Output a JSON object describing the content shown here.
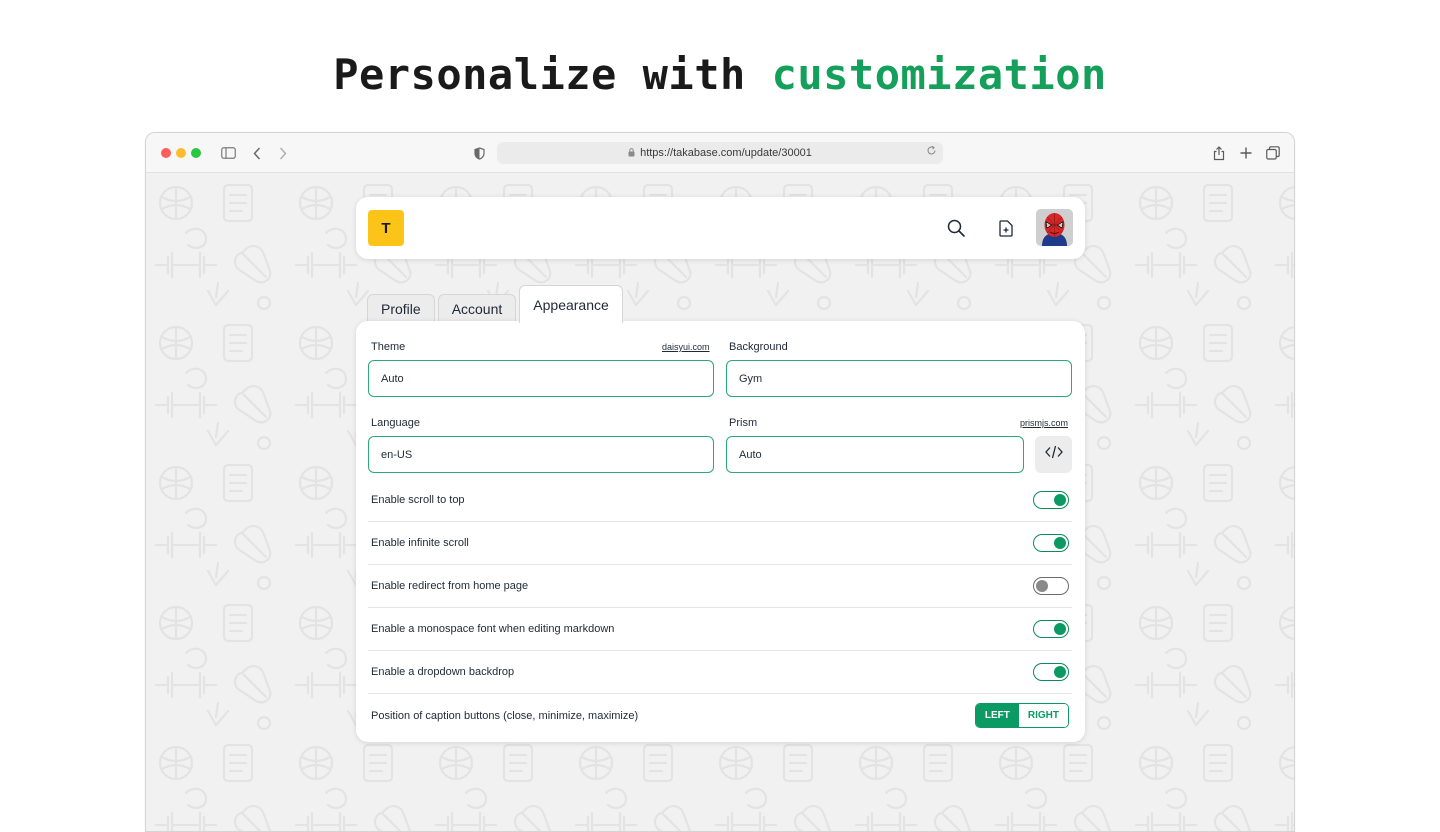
{
  "headline": {
    "lead": "Personalize with",
    "accent": "customization"
  },
  "colors": {
    "accent": "#14a05a",
    "toggle_on": "#0b9a63",
    "logo_bg": "#fcc419"
  },
  "browser": {
    "url": "https://takabase.com/update/30001",
    "icons": [
      "sidebar-icon",
      "back-icon",
      "forward-icon",
      "shield-icon",
      "lock-icon",
      "reload-icon",
      "share-icon",
      "new-tab-icon",
      "tabs-overview-icon"
    ]
  },
  "navbar": {
    "logo_letter": "T",
    "icons": [
      "search-icon",
      "new-document-icon",
      "avatar"
    ]
  },
  "tabs": [
    {
      "label": "Profile",
      "active": false
    },
    {
      "label": "Account",
      "active": false
    },
    {
      "label": "Appearance",
      "active": true
    }
  ],
  "fields": {
    "theme": {
      "label": "Theme",
      "link": "daisyui.com",
      "value": "Auto"
    },
    "background": {
      "label": "Background",
      "value": "Gym"
    },
    "language": {
      "label": "Language",
      "value": "en-US"
    },
    "prism": {
      "label": "Prism",
      "link": "prismjs.com",
      "value": "Auto",
      "button_icon": "code-icon"
    }
  },
  "settings": [
    {
      "label": "Enable scroll to top",
      "enabled": true
    },
    {
      "label": "Enable infinite scroll",
      "enabled": true
    },
    {
      "label": "Enable redirect from home page",
      "enabled": false
    },
    {
      "label": "Enable a monospace font when editing markdown",
      "enabled": true
    },
    {
      "label": "Enable a dropdown backdrop",
      "enabled": true
    }
  ],
  "caption_position": {
    "label": "Position of caption buttons (close, minimize, maximize)",
    "options": [
      "LEFT",
      "RIGHT"
    ],
    "selected": "LEFT"
  }
}
